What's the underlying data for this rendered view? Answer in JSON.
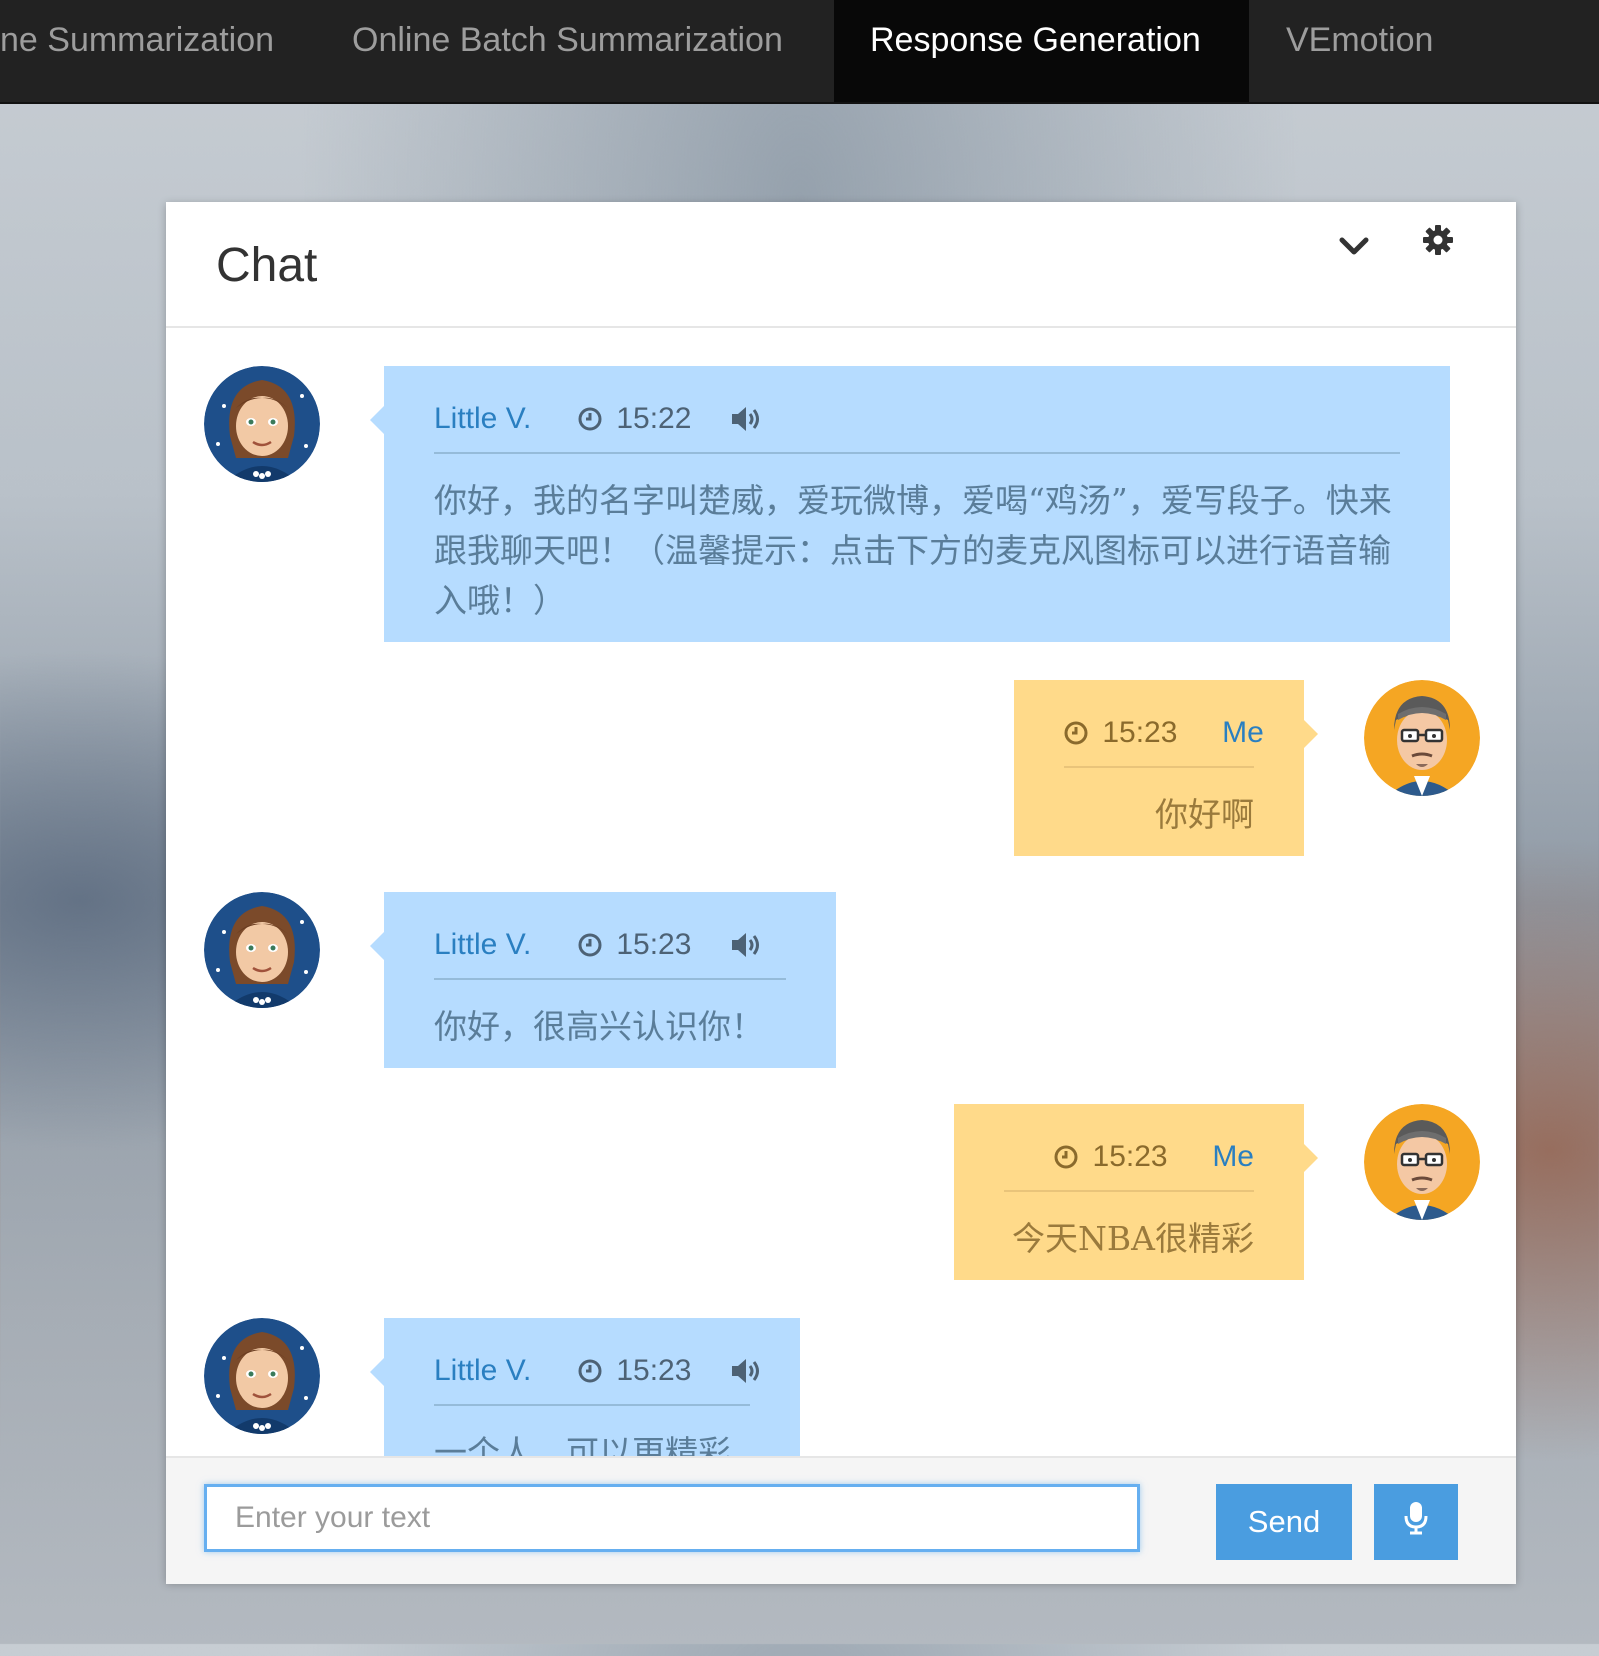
{
  "nav": {
    "tabs": [
      {
        "label": "ne Summarization"
      },
      {
        "label": "Online Batch Summarization"
      },
      {
        "label": "Response Generation",
        "active": true
      },
      {
        "label": "VEmotion"
      }
    ]
  },
  "chat": {
    "title": "Chat",
    "messages": [
      {
        "sender": "Little V.",
        "time": "15:22",
        "text": "你好，我的名字叫楚威，爱玩微博，爱喝“鸡汤”，爱写段子。快来跟我聊天吧！（温馨提示：点击下方的麦克风图标可以进行语音输入哦！）"
      },
      {
        "sender": "Me",
        "time": "15:23",
        "text": "你好啊"
      },
      {
        "sender": "Little V.",
        "time": "15:23",
        "text": "你好，很高兴认识你！"
      },
      {
        "sender": "Me",
        "time": "15:23",
        "text": "今天NBA很精彩"
      },
      {
        "sender": "Little V.",
        "time": "15:23",
        "text": "一个人，可以更精彩"
      }
    ]
  },
  "footer": {
    "input_placeholder": "Enter your text",
    "send_label": "Send"
  },
  "colors": {
    "nav_bg": "#222222",
    "nav_active_bg": "#080808",
    "bot_bubble": "#b6dcff",
    "me_bubble": "#ffda8a",
    "accent": "#4a9de0"
  },
  "icons": [
    "chevron-down-icon",
    "gear-icon",
    "clock-icon",
    "speaker-icon",
    "microphone-icon",
    "avatar-bot",
    "avatar-user"
  ]
}
